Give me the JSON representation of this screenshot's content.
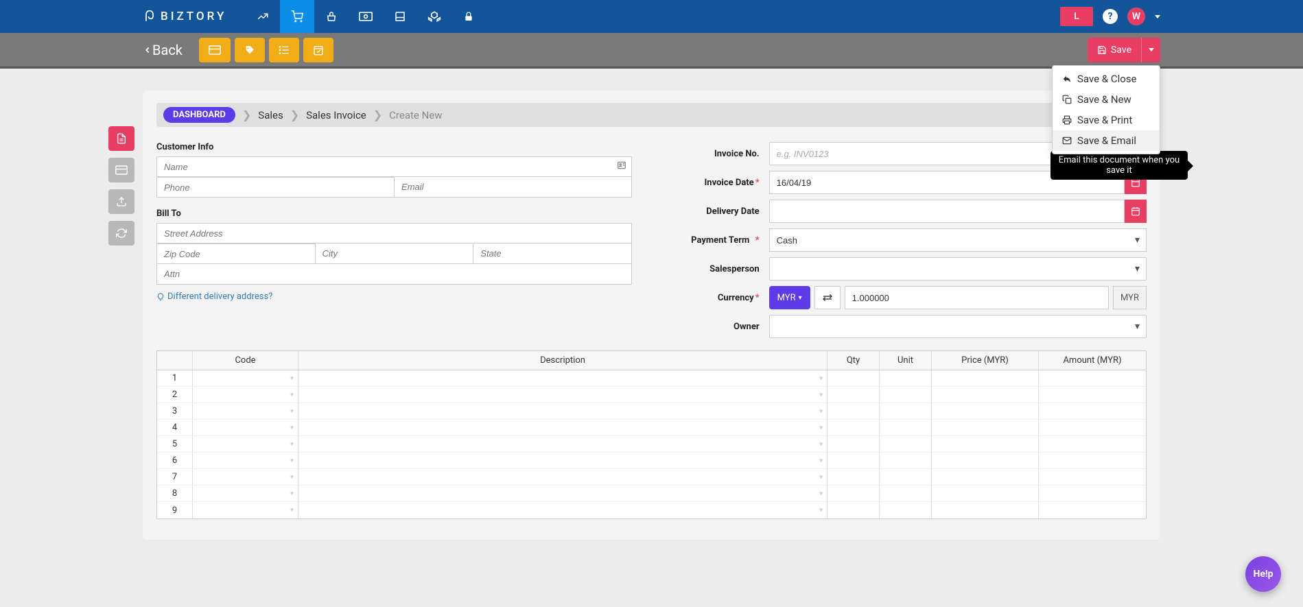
{
  "brand": "BIZTORY",
  "top_right": {
    "badge": "L",
    "help": "?",
    "avatar_initial": "W"
  },
  "toolbar": {
    "back": "Back",
    "save": "Save",
    "dropdown": {
      "save_close": "Save & Close",
      "save_new": "Save & New",
      "save_print": "Save & Print",
      "save_email": "Save & Email"
    },
    "tooltip": "Email this document when you save it"
  },
  "breadcrumb": {
    "dashboard": "DASHBOARD",
    "sales": "Sales",
    "sales_invoice": "Sales Invoice",
    "create_new": "Create New"
  },
  "left": {
    "customer_info": "Customer Info",
    "name_ph": "Name",
    "phone_ph": "Phone",
    "email_ph": "Email",
    "bill_to": "Bill To",
    "street_ph": "Street Address",
    "zip_ph": "Zip Code",
    "city_ph": "City",
    "state_ph": "State",
    "attn_ph": "Attn",
    "diff_delivery": "Different delivery address?"
  },
  "right": {
    "invoice_no_label": "Invoice No.",
    "invoice_no_ph": "e.g. INV0123",
    "invoice_date_label": "Invoice Date",
    "invoice_date_value": "16/04/19",
    "delivery_date_label": "Delivery Date",
    "payment_term_label": "Payment Term",
    "payment_term_value": "Cash",
    "salesperson_label": "Salesperson",
    "currency_label": "Currency",
    "currency_btn": "MYR",
    "currency_rate": "1.000000",
    "currency_suffix": "MYR",
    "owner_label": "Owner"
  },
  "table": {
    "headers": {
      "code": "Code",
      "description": "Description",
      "qty": "Qty",
      "unit": "Unit",
      "price": "Price (MYR)",
      "amount": "Amount (MYR)"
    },
    "rows": [
      "1",
      "2",
      "3",
      "4",
      "5",
      "6",
      "7",
      "8",
      "9"
    ]
  },
  "help_fab": "He!p"
}
